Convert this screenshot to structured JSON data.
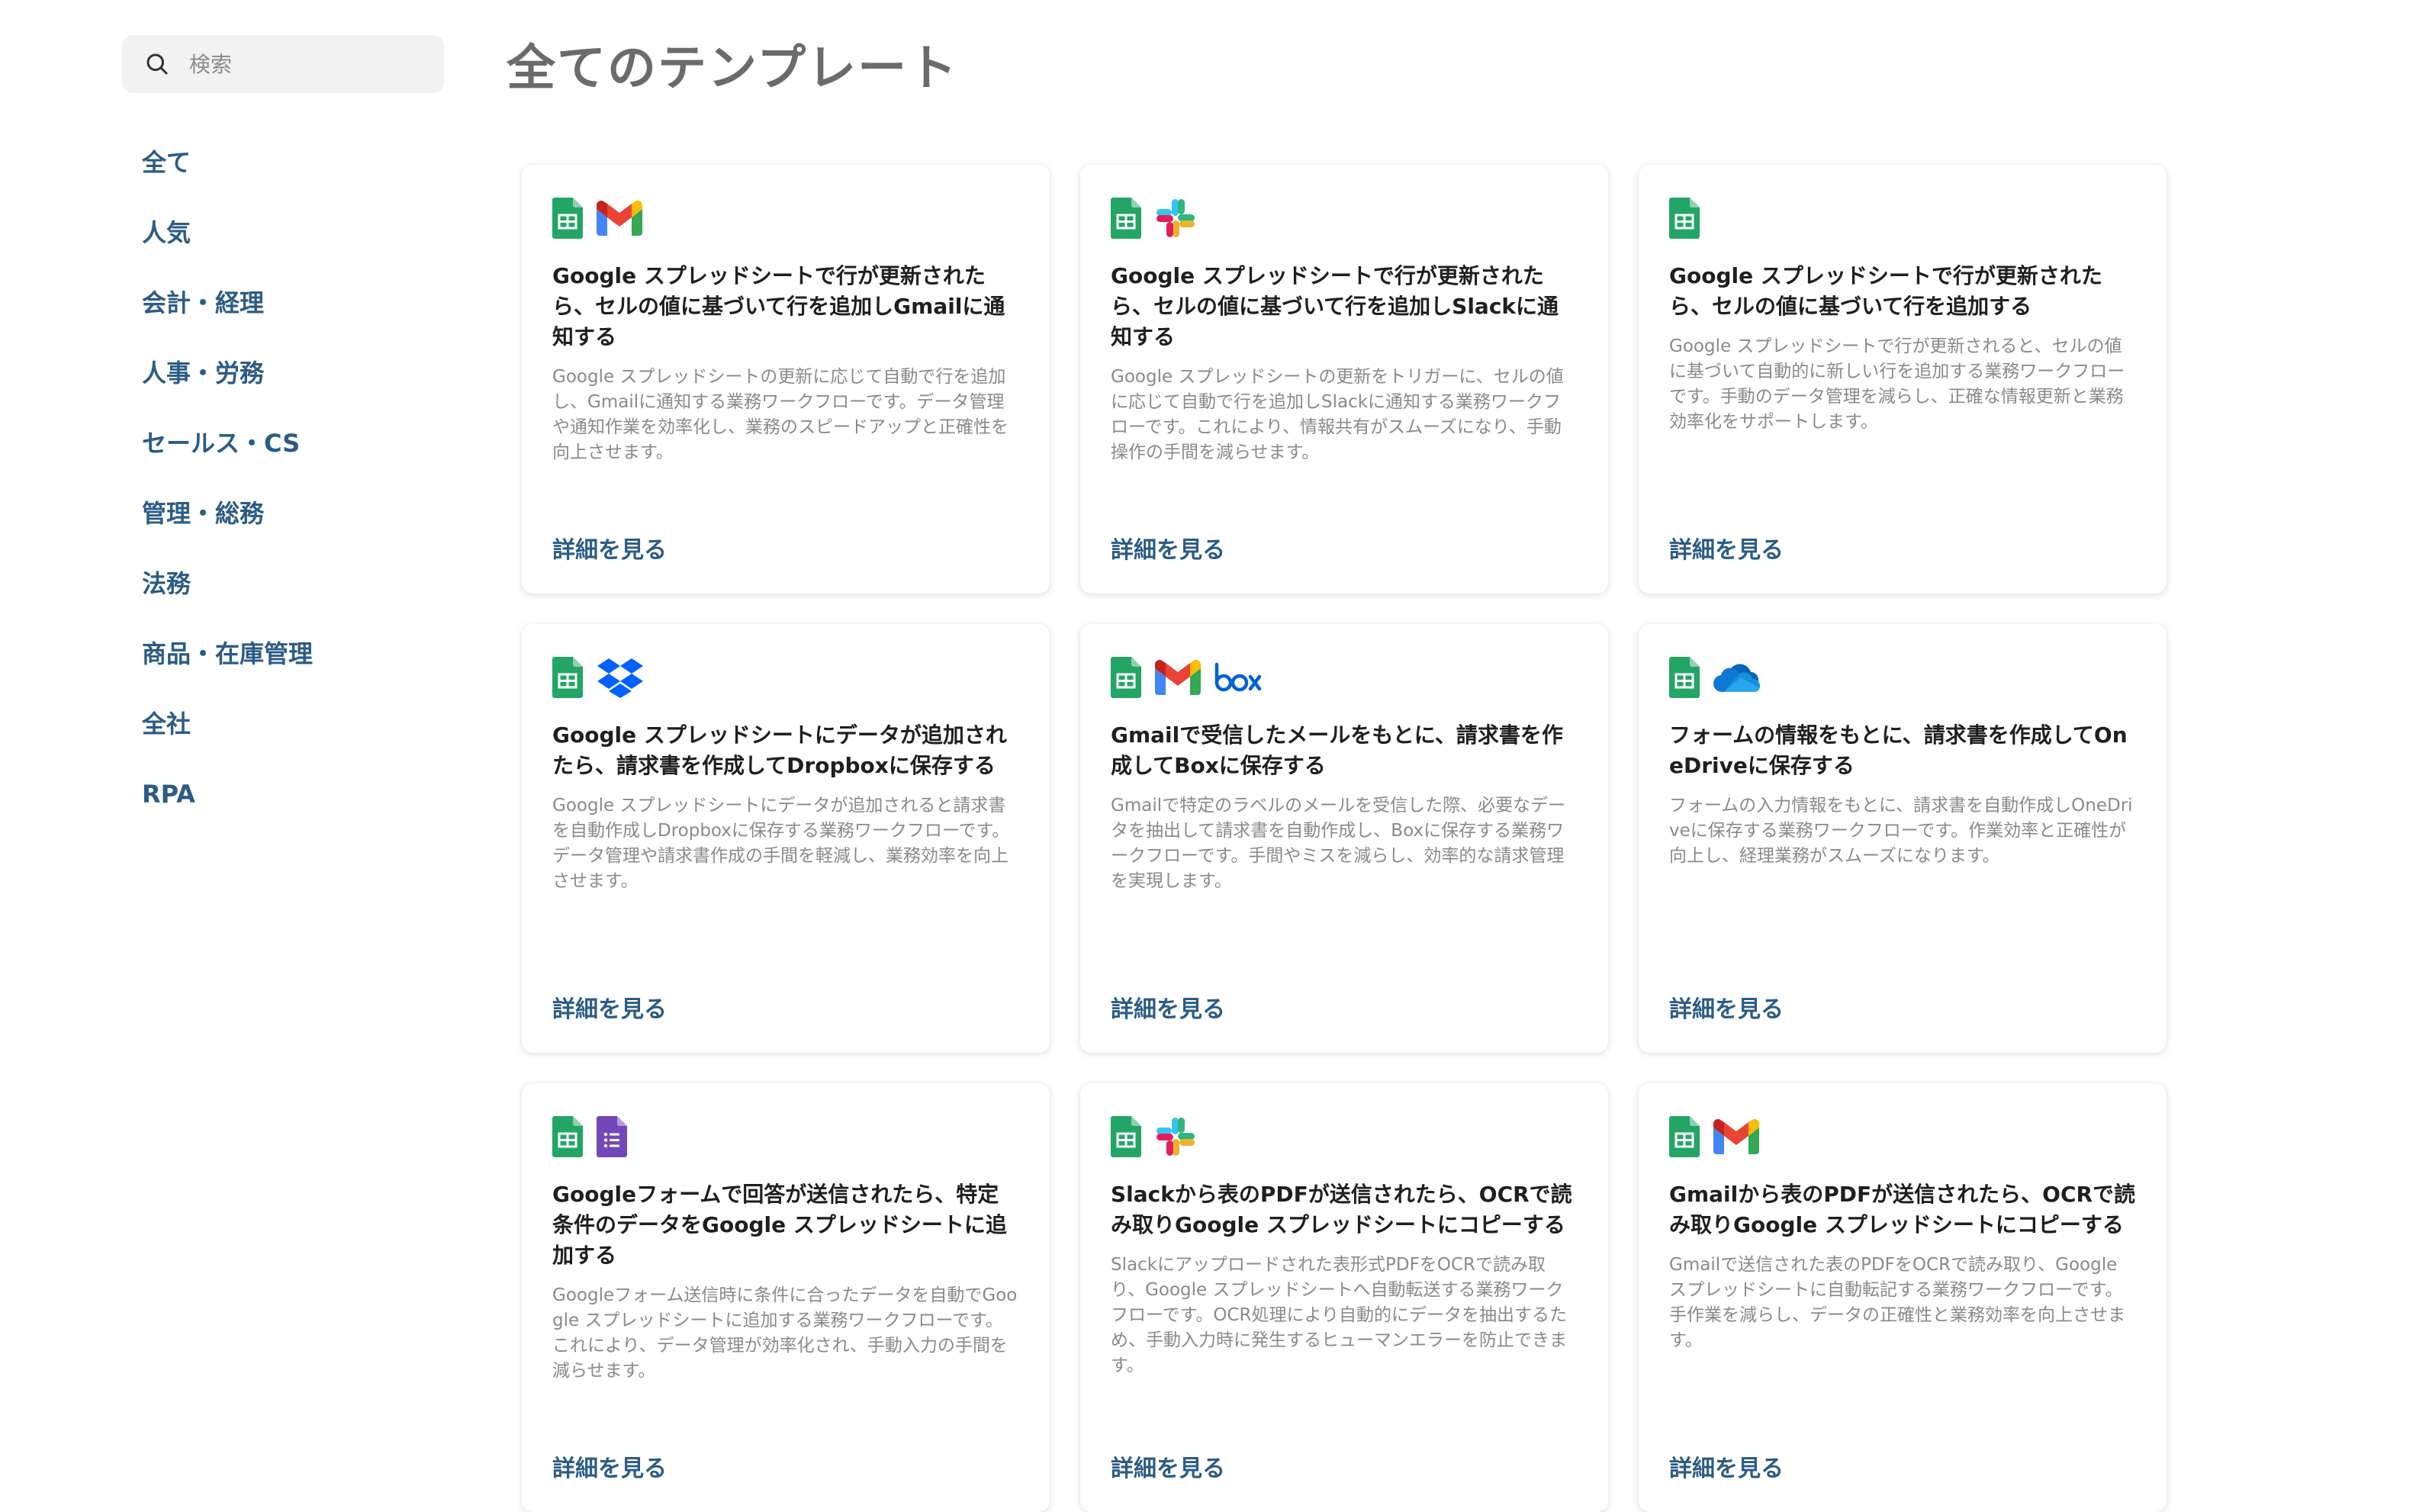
{
  "search": {
    "placeholder": "検索"
  },
  "sidebar": {
    "categories": [
      "全て",
      "人気",
      "会計・経理",
      "人事・労務",
      "セールス・CS",
      "管理・総務",
      "法務",
      "商品・在庫管理",
      "全社",
      "RPA"
    ]
  },
  "main": {
    "title": "全てのテンプレート"
  },
  "cards": [
    {
      "icons": [
        "google-sheets-icon",
        "gmail-icon"
      ],
      "title": "Google スプレッドシートで行が更新されたら、セルの値に基づいて行を追加しGmailに通知する",
      "description": "Google スプレッドシートの更新に応じて自動で行を追加し、Gmailに通知する業務ワークフローです。データ管理や通知作業を効率化し、業務のスピードアップと正確性を向上させます。",
      "link": "詳細を見る"
    },
    {
      "icons": [
        "google-sheets-icon",
        "slack-icon"
      ],
      "title": "Google スプレッドシートで行が更新されたら、セルの値に基づいて行を追加しSlackに通知する",
      "description": "Google スプレッドシートの更新をトリガーに、セルの値に応じて自動で行を追加しSlackに通知する業務ワークフローです。これにより、情報共有がスムーズになり、手動操作の手間を減らせます。",
      "link": "詳細を見る"
    },
    {
      "icons": [
        "google-sheets-icon"
      ],
      "title": "Google スプレッドシートで行が更新されたら、セルの値に基づいて行を追加する",
      "description": "Google スプレッドシートで行が更新されると、セルの値に基づいて自動的に新しい行を追加する業務ワークフローです。手動のデータ管理を減らし、正確な情報更新と業務効率化をサポートします。",
      "link": "詳細を見る"
    },
    {
      "icons": [
        "google-sheets-icon",
        "dropbox-icon"
      ],
      "title": "Google スプレッドシートにデータが追加されたら、請求書を作成してDropboxに保存する",
      "description": "Google スプレッドシートにデータが追加されると請求書を自動作成しDropboxに保存する業務ワークフローです。データ管理や請求書作成の手間を軽減し、業務効率を向上させます。",
      "link": "詳細を見る"
    },
    {
      "icons": [
        "google-sheets-icon",
        "gmail-icon",
        "box-icon"
      ],
      "title": "Gmailで受信したメールをもとに、請求書を作成してBoxに保存する",
      "description": "Gmailで特定のラベルのメールを受信した際、必要なデータを抽出して請求書を自動作成し、Boxに保存する業務ワークフローです。手間やミスを減らし、効率的な請求管理を実現します。",
      "link": "詳細を見る"
    },
    {
      "icons": [
        "google-sheets-icon",
        "onedrive-icon"
      ],
      "title": "フォームの情報をもとに、請求書を作成してOneDriveに保存する",
      "description": "フォームの入力情報をもとに、請求書を自動作成しOneDriveに保存する業務ワークフローです。作業効率と正確性が向上し、経理業務がスムーズになります。",
      "link": "詳細を見る"
    },
    {
      "icons": [
        "google-sheets-icon",
        "google-forms-icon"
      ],
      "title": "Googleフォームで回答が送信されたら、特定条件のデータをGoogle スプレッドシートに追加する",
      "description": "Googleフォーム送信時に条件に合ったデータを自動でGoogle スプレッドシートに追加する業務ワークフローです。これにより、データ管理が効率化され、手動入力の手間を減らせます。",
      "link": "詳細を見る"
    },
    {
      "icons": [
        "google-sheets-icon",
        "slack-icon"
      ],
      "title": "Slackから表のPDFが送信されたら、OCRで読み取りGoogle スプレッドシートにコピーする",
      "description": "Slackにアップロードされた表形式PDFをOCRで読み取り、Google スプレッドシートへ自動転送する業務ワークフローです。OCR処理により自動的にデータを抽出するため、手動入力時に発生するヒューマンエラーを防止できます。",
      "link": "詳細を見る"
    },
    {
      "icons": [
        "google-sheets-icon",
        "gmail-icon"
      ],
      "title": "Gmailから表のPDFが送信されたら、OCRで読み取りGoogle スプレッドシートにコピーする",
      "description": "Gmailで送信された表のPDFをOCRで読み取り、Google スプレッドシートに自動転記する業務ワークフローです。手作業を減らし、データの正確性と業務効率を向上させます。",
      "link": "詳細を見る"
    }
  ]
}
